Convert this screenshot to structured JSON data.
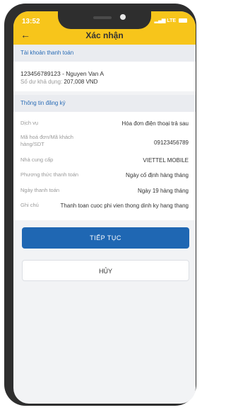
{
  "status": {
    "time": "13:52",
    "network": "LTE"
  },
  "header": {
    "title": "Xác nhận"
  },
  "account_section": {
    "heading": "Tài khoản thanh toán",
    "account_line": "123456789123 - Nguyen Van A",
    "balance_label": "Số dư khả dụng:",
    "balance_value": "207,008 VND"
  },
  "registration_section": {
    "heading": "Thông tin đăng ký",
    "rows": [
      {
        "label": "Dịch vụ",
        "value": "Hóa đơn điện thoại trả sau"
      },
      {
        "label": "Mã hoá đơn/Mã khách hàng/SDT",
        "value": "09123456789"
      },
      {
        "label": "Nhà cung cấp",
        "value": "VIETTEL MOBILE"
      },
      {
        "label": "Phương thức thanh toán",
        "value": "Ngày cố định hàng tháng"
      },
      {
        "label": "Ngày thanh toán",
        "value": "Ngày 19 hàng tháng"
      },
      {
        "label": "Ghi chú",
        "value": "Thanh toan cuoc phi vien thong dinh ky hang thang"
      }
    ]
  },
  "buttons": {
    "continue": "TIẾP TỤC",
    "cancel": "HỦY"
  }
}
